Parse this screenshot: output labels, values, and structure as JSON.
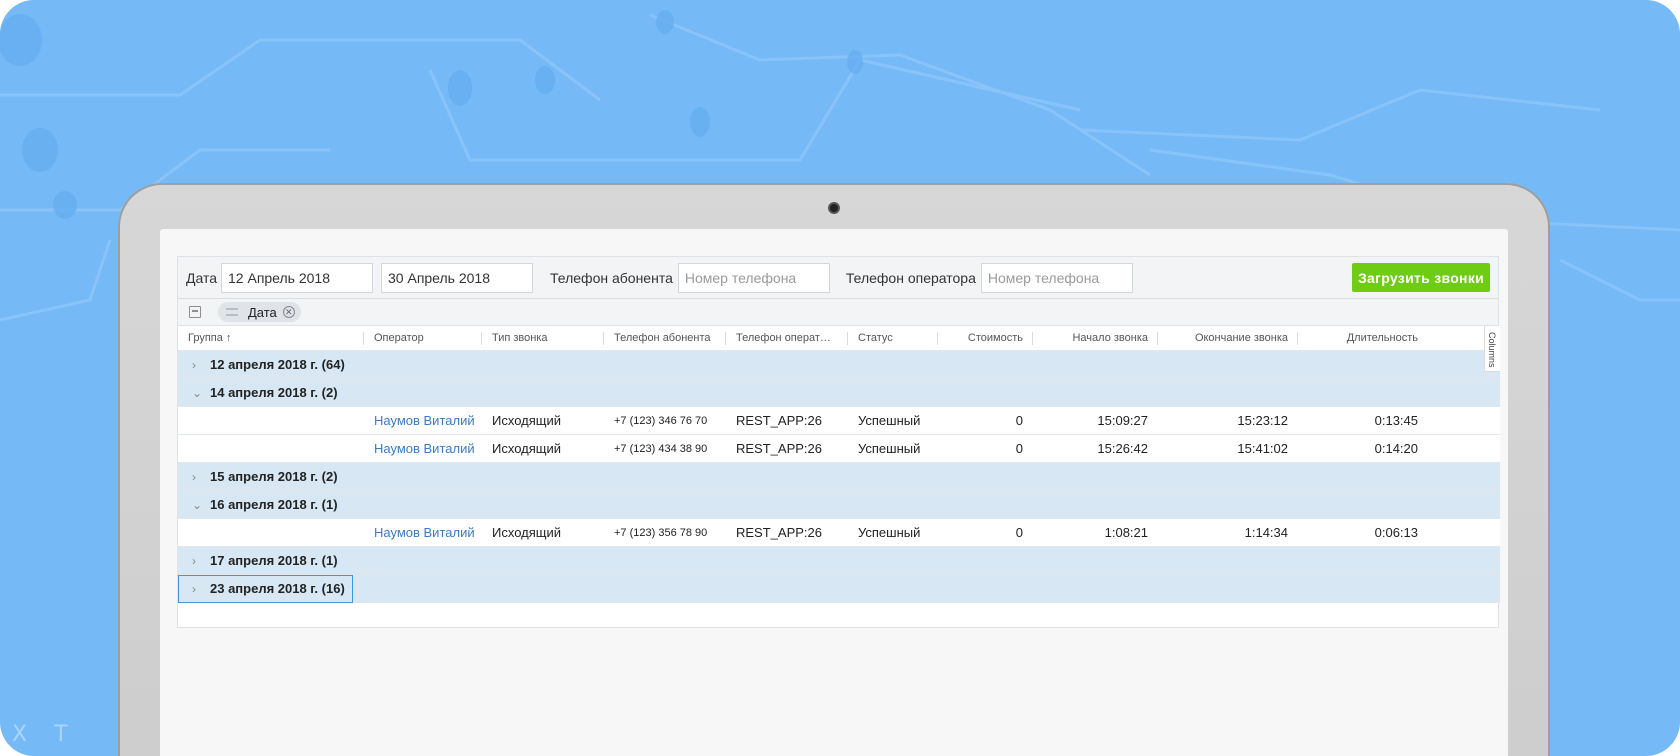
{
  "colors": {
    "background": "#76b9f7",
    "accent_button": "#6fcc14",
    "group_row": "#d7e8f4",
    "link": "#3b7bc0",
    "selection": "#3e95e0"
  },
  "watermark": "X T",
  "filters": {
    "date_label": "Дата",
    "date_from": "12 Апрель 2018",
    "date_to": "30 Апрель 2018",
    "subscriber_label": "Телефон абонента",
    "subscriber_placeholder": "Номер телефона",
    "operator_label": "Телефон оператора",
    "operator_placeholder": "Номер телефона",
    "load_button": "Загрузить звонки"
  },
  "grouping": {
    "chip_label": "Дата",
    "toggle_icon": "group-panel-icon"
  },
  "columns_panel": "Columns",
  "headers": [
    "Группа ↑",
    "Оператор",
    "Тип звонка",
    "Телефон абонента",
    "Телефон операт…",
    "Статус",
    "Стоимость",
    "Начало звонка",
    "Окончание звонка",
    "Длительность"
  ],
  "rows": [
    {
      "type": "group",
      "expanded": false,
      "label": "12 апреля 2018 г. (64)"
    },
    {
      "type": "group",
      "expanded": true,
      "label": "14 апреля 2018 г. (2)"
    },
    {
      "type": "data",
      "operator": "Наумов Виталий",
      "call_type": "Исходящий",
      "subscriber": "+7 (123) 346 76 70",
      "operator_phone": "REST_APP:26",
      "status": "Успешный",
      "cost": "0",
      "start": "15:09:27",
      "end": "15:23:12",
      "duration": "0:13:45"
    },
    {
      "type": "data",
      "operator": "Наумов Виталий",
      "call_type": "Исходящий",
      "subscriber": "+7 (123) 434 38 90",
      "operator_phone": "REST_APP:26",
      "status": "Успешный",
      "cost": "0",
      "start": "15:26:42",
      "end": "15:41:02",
      "duration": "0:14:20"
    },
    {
      "type": "group",
      "expanded": false,
      "label": "15 апреля 2018 г. (2)"
    },
    {
      "type": "group",
      "expanded": true,
      "label": "16 апреля 2018 г. (1)"
    },
    {
      "type": "data",
      "operator": "Наумов Виталий",
      "call_type": "Исходящий",
      "subscriber": "+7 (123) 356 78 90",
      "operator_phone": "REST_APP:26",
      "status": "Успешный",
      "cost": "0",
      "start": "1:08:21",
      "end": "1:14:34",
      "duration": "0:06:13"
    },
    {
      "type": "group",
      "expanded": false,
      "label": "17 апреля 2018 г. (1)"
    },
    {
      "type": "group",
      "expanded": false,
      "label": "23 апреля 2018 г. (16)",
      "selected": true
    }
  ]
}
